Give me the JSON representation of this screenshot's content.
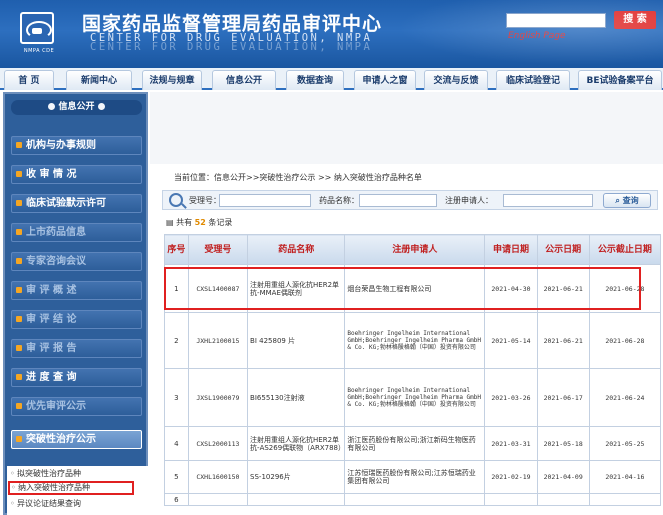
{
  "header": {
    "logo_code": "NMPA CDE",
    "title": "国家药品监督管理局药品审评中心",
    "subtitle_en": "CENTER  FOR  DRUG EVALUATION,  NMPA",
    "english_link": "English Page",
    "search_label": "搜 索"
  },
  "nav": {
    "items": [
      "首 页",
      "新闻中心",
      "法规与规章",
      "信息公开",
      "数据查询",
      "申请人之窗",
      "交流与反馈",
      "临床试验登记",
      "BE试验备案平台"
    ]
  },
  "sidebar": {
    "title": "信息公开",
    "items": [
      {
        "label": "机构与办事规则",
        "ghost": false
      },
      {
        "label": "收 审 情 况",
        "ghost": false
      },
      {
        "label": "临床试验默示许可",
        "ghost": false
      },
      {
        "label": "上市药品信息",
        "ghost": true
      },
      {
        "label": "专家咨询会议",
        "ghost": true
      },
      {
        "label": "审 评 概 述",
        "ghost": true
      },
      {
        "label": "审 评 结 论",
        "ghost": true
      },
      {
        "label": "审 评 报 告",
        "ghost": true
      },
      {
        "label": "进 度 查 询",
        "ghost": false
      },
      {
        "label": "优先审评公示",
        "ghost": true
      },
      {
        "label": "突破性治疗公示",
        "ghost": true
      }
    ],
    "sub_items": [
      "拟突破性治疗品种",
      "纳入突破性治疗品种",
      "异议论证结果查询"
    ]
  },
  "main": {
    "breadcrumb": "当前位置：信息公开>>突破性治疗公示 >> 纳入突破性治疗品种名单",
    "filter": {
      "accept_label": "受理号：",
      "drug_label": "药品名称：",
      "applicant_label": "注册申请人：",
      "query_btn": "查询"
    },
    "count_prefix": "共有",
    "count_num": "52",
    "count_suffix": "条记录",
    "table": {
      "headers": [
        "序号",
        "受理号",
        "药品名称",
        "注册申请人",
        "申请日期",
        "公示日期",
        "公示截止日期"
      ],
      "rows": [
        [
          "1",
          "CXSL1400087",
          "注射用重组人源化抗HER2单抗-MMAE偶联剂",
          "烟台荣昌生物工程有限公司",
          "2021-04-30",
          "2021-06-21",
          "2021-06-28"
        ],
        [
          "2",
          "JXHL2100015",
          "BI 425809 片",
          "Boehringer Ingelheim International GmbH;Boehringer Ingelheim Pharma GmbH & Co. KG;勃林格殷格翰（中国）投资有限公司",
          "2021-05-14",
          "2021-06-21",
          "2021-06-28"
        ],
        [
          "3",
          "JXSL1900079",
          "BI655130注射液",
          "Boehringer Ingelheim International GmbH;Boehringer Ingelheim Pharma GmbH & Co. KG;勃林格殷格翰（中国）投资有限公司",
          "2021-03-26",
          "2021-06-17",
          "2021-06-24"
        ],
        [
          "4",
          "CXSL2000113",
          "注射用重组人源化抗HER2单抗-AS269偶联物（ARX788）",
          "浙江医药股份有限公司;浙江新码生物医药有限公司",
          "2021-03-31",
          "2021-05-18",
          "2021-05-25"
        ],
        [
          "5",
          "CXHL1600150",
          "SS-10296片",
          "江苏恒瑞医药股份有限公司;江苏恒瑞药业集团有限公司",
          "2021-02-19",
          "2021-04-09",
          "2021-04-16"
        ],
        [
          "6",
          "",
          "",
          "",
          "",
          "",
          ""
        ]
      ]
    }
  }
}
